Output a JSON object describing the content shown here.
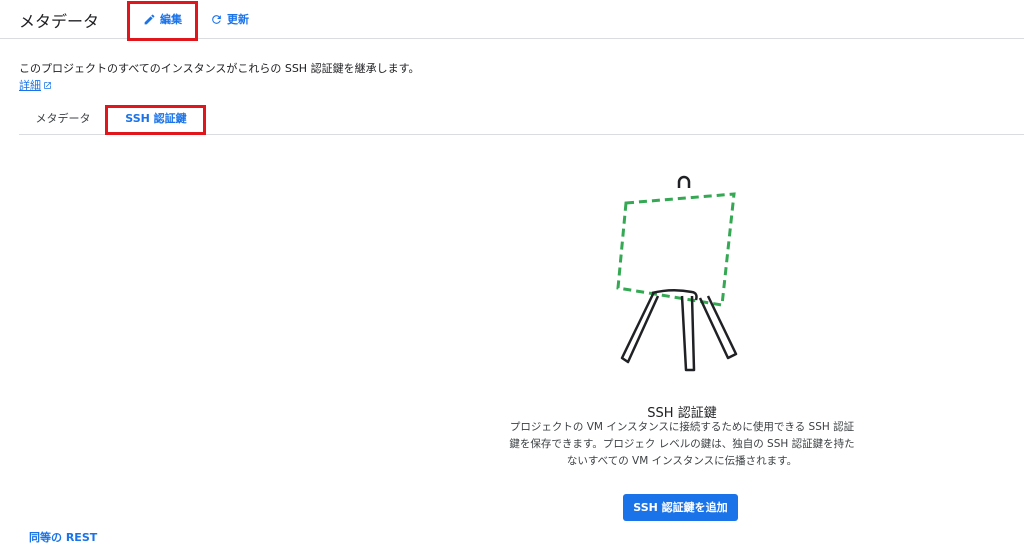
{
  "header": {
    "title": "メタデータ",
    "edit_label": "編集",
    "refresh_label": "更新",
    "edit_icon": "pencil-icon",
    "refresh_icon": "refresh-icon"
  },
  "description": "このプロジェクトのすべてのインスタンスがこれらの SSH 認証鍵を継承します。",
  "learn_more": "詳細",
  "tabs": [
    {
      "label": "メタデータ",
      "selected": false
    },
    {
      "label": "SSH 認証鍵",
      "selected": true
    }
  ],
  "empty_state": {
    "title": "SSH 認証鍵",
    "body_lines": [
      "プロジェクトの VM インスタンスに接続するために使用できる SSH 認証",
      "鍵を保存できます。プロジェク レベルの鍵は、独自の SSH 認証鍵を持た",
      "ないすべての VM インスタンスに伝播されます。"
    ],
    "button_label": "SSH 認証鍵を追加"
  },
  "footer": {
    "rest_label": "同等の REST"
  },
  "colors": {
    "accent": "#1a73e8",
    "highlight": "#e0161c",
    "easel_dash": "#34a853"
  }
}
